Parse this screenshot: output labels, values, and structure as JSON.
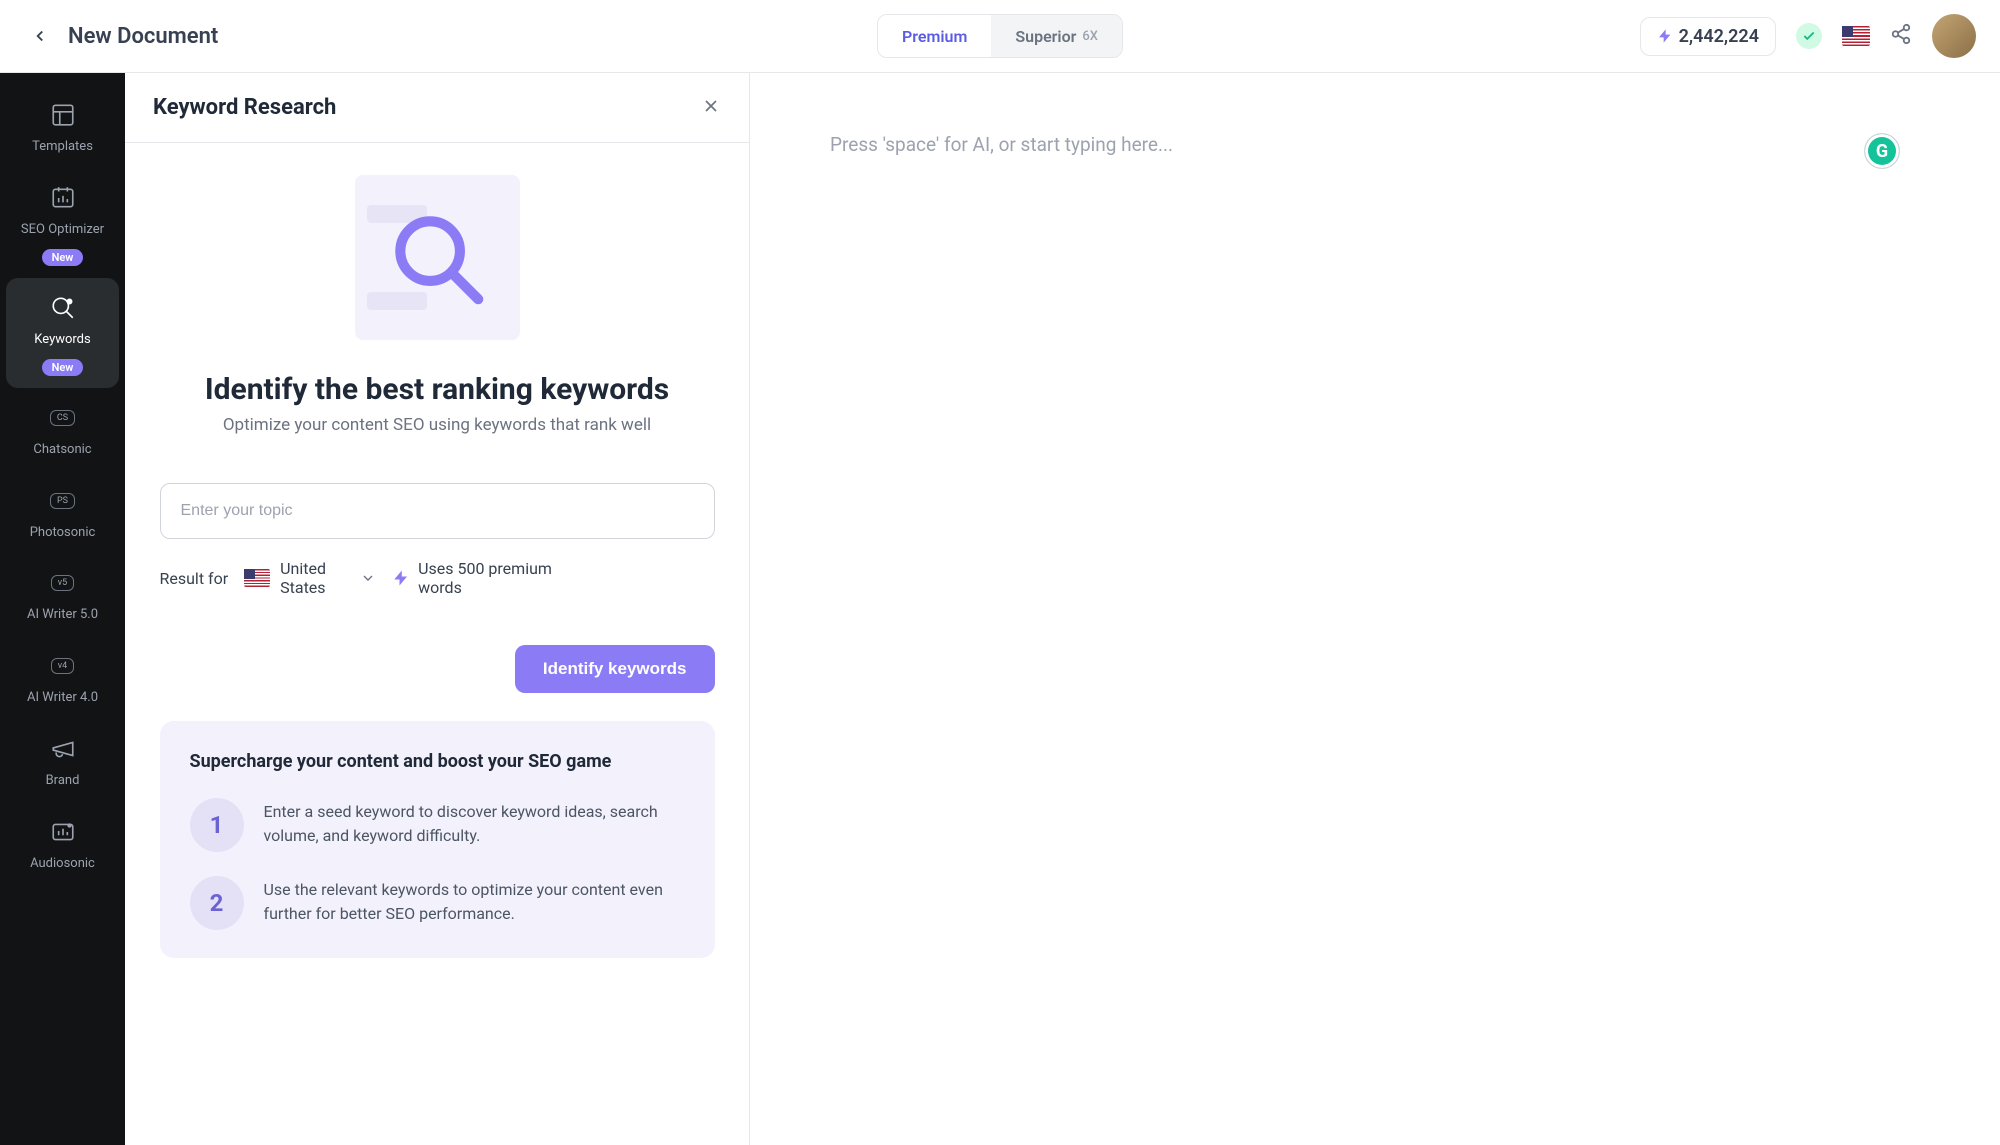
{
  "topbar": {
    "doc_title": "New Document",
    "plan": {
      "premium_label": "Premium",
      "superior_label": "Superior",
      "superior_badge": "6X"
    },
    "credits": "2,442,224"
  },
  "sidebar": {
    "items": [
      {
        "label": "Templates",
        "icon": "templates-icon",
        "badge": null
      },
      {
        "label": "SEO Optimizer",
        "icon": "seo-optimizer-icon",
        "badge": "New"
      },
      {
        "label": "Keywords",
        "icon": "keywords-icon",
        "badge": "New"
      },
      {
        "label": "Chatsonic",
        "icon": "chatsonic-icon",
        "badge": null,
        "mini": "CS"
      },
      {
        "label": "Photosonic",
        "icon": "photosonic-icon",
        "badge": null,
        "mini": "PS"
      },
      {
        "label": "AI Writer 5.0",
        "icon": "ai-writer-5-icon",
        "badge": null,
        "mini": "v5"
      },
      {
        "label": "AI Writer 4.0",
        "icon": "ai-writer-4-icon",
        "badge": null,
        "mini": "v4"
      },
      {
        "label": "Brand",
        "icon": "brand-icon",
        "badge": null
      },
      {
        "label": "Audiosonic",
        "icon": "audiosonic-icon",
        "badge": null
      }
    ]
  },
  "panel": {
    "title": "Keyword Research",
    "hero_headline": "Identify the best ranking keywords",
    "hero_sub": "Optimize your content SEO using keywords that rank well",
    "input_placeholder": "Enter your topic",
    "result_for_label": "Result for",
    "country": "United States",
    "usage_text": "Uses 500 premium words",
    "identify_button": "Identify keywords",
    "info_title": "Supercharge your content and boost your SEO game",
    "steps": [
      {
        "num": "1",
        "text": "Enter a seed keyword to discover keyword ideas, search volume, and keyword difficulty."
      },
      {
        "num": "2",
        "text": "Use the relevant keywords to optimize your content even further for better SEO performance."
      }
    ]
  },
  "editor": {
    "placeholder": "Press 'space' for AI, or start typing here..."
  },
  "badges": {
    "new": "New"
  }
}
